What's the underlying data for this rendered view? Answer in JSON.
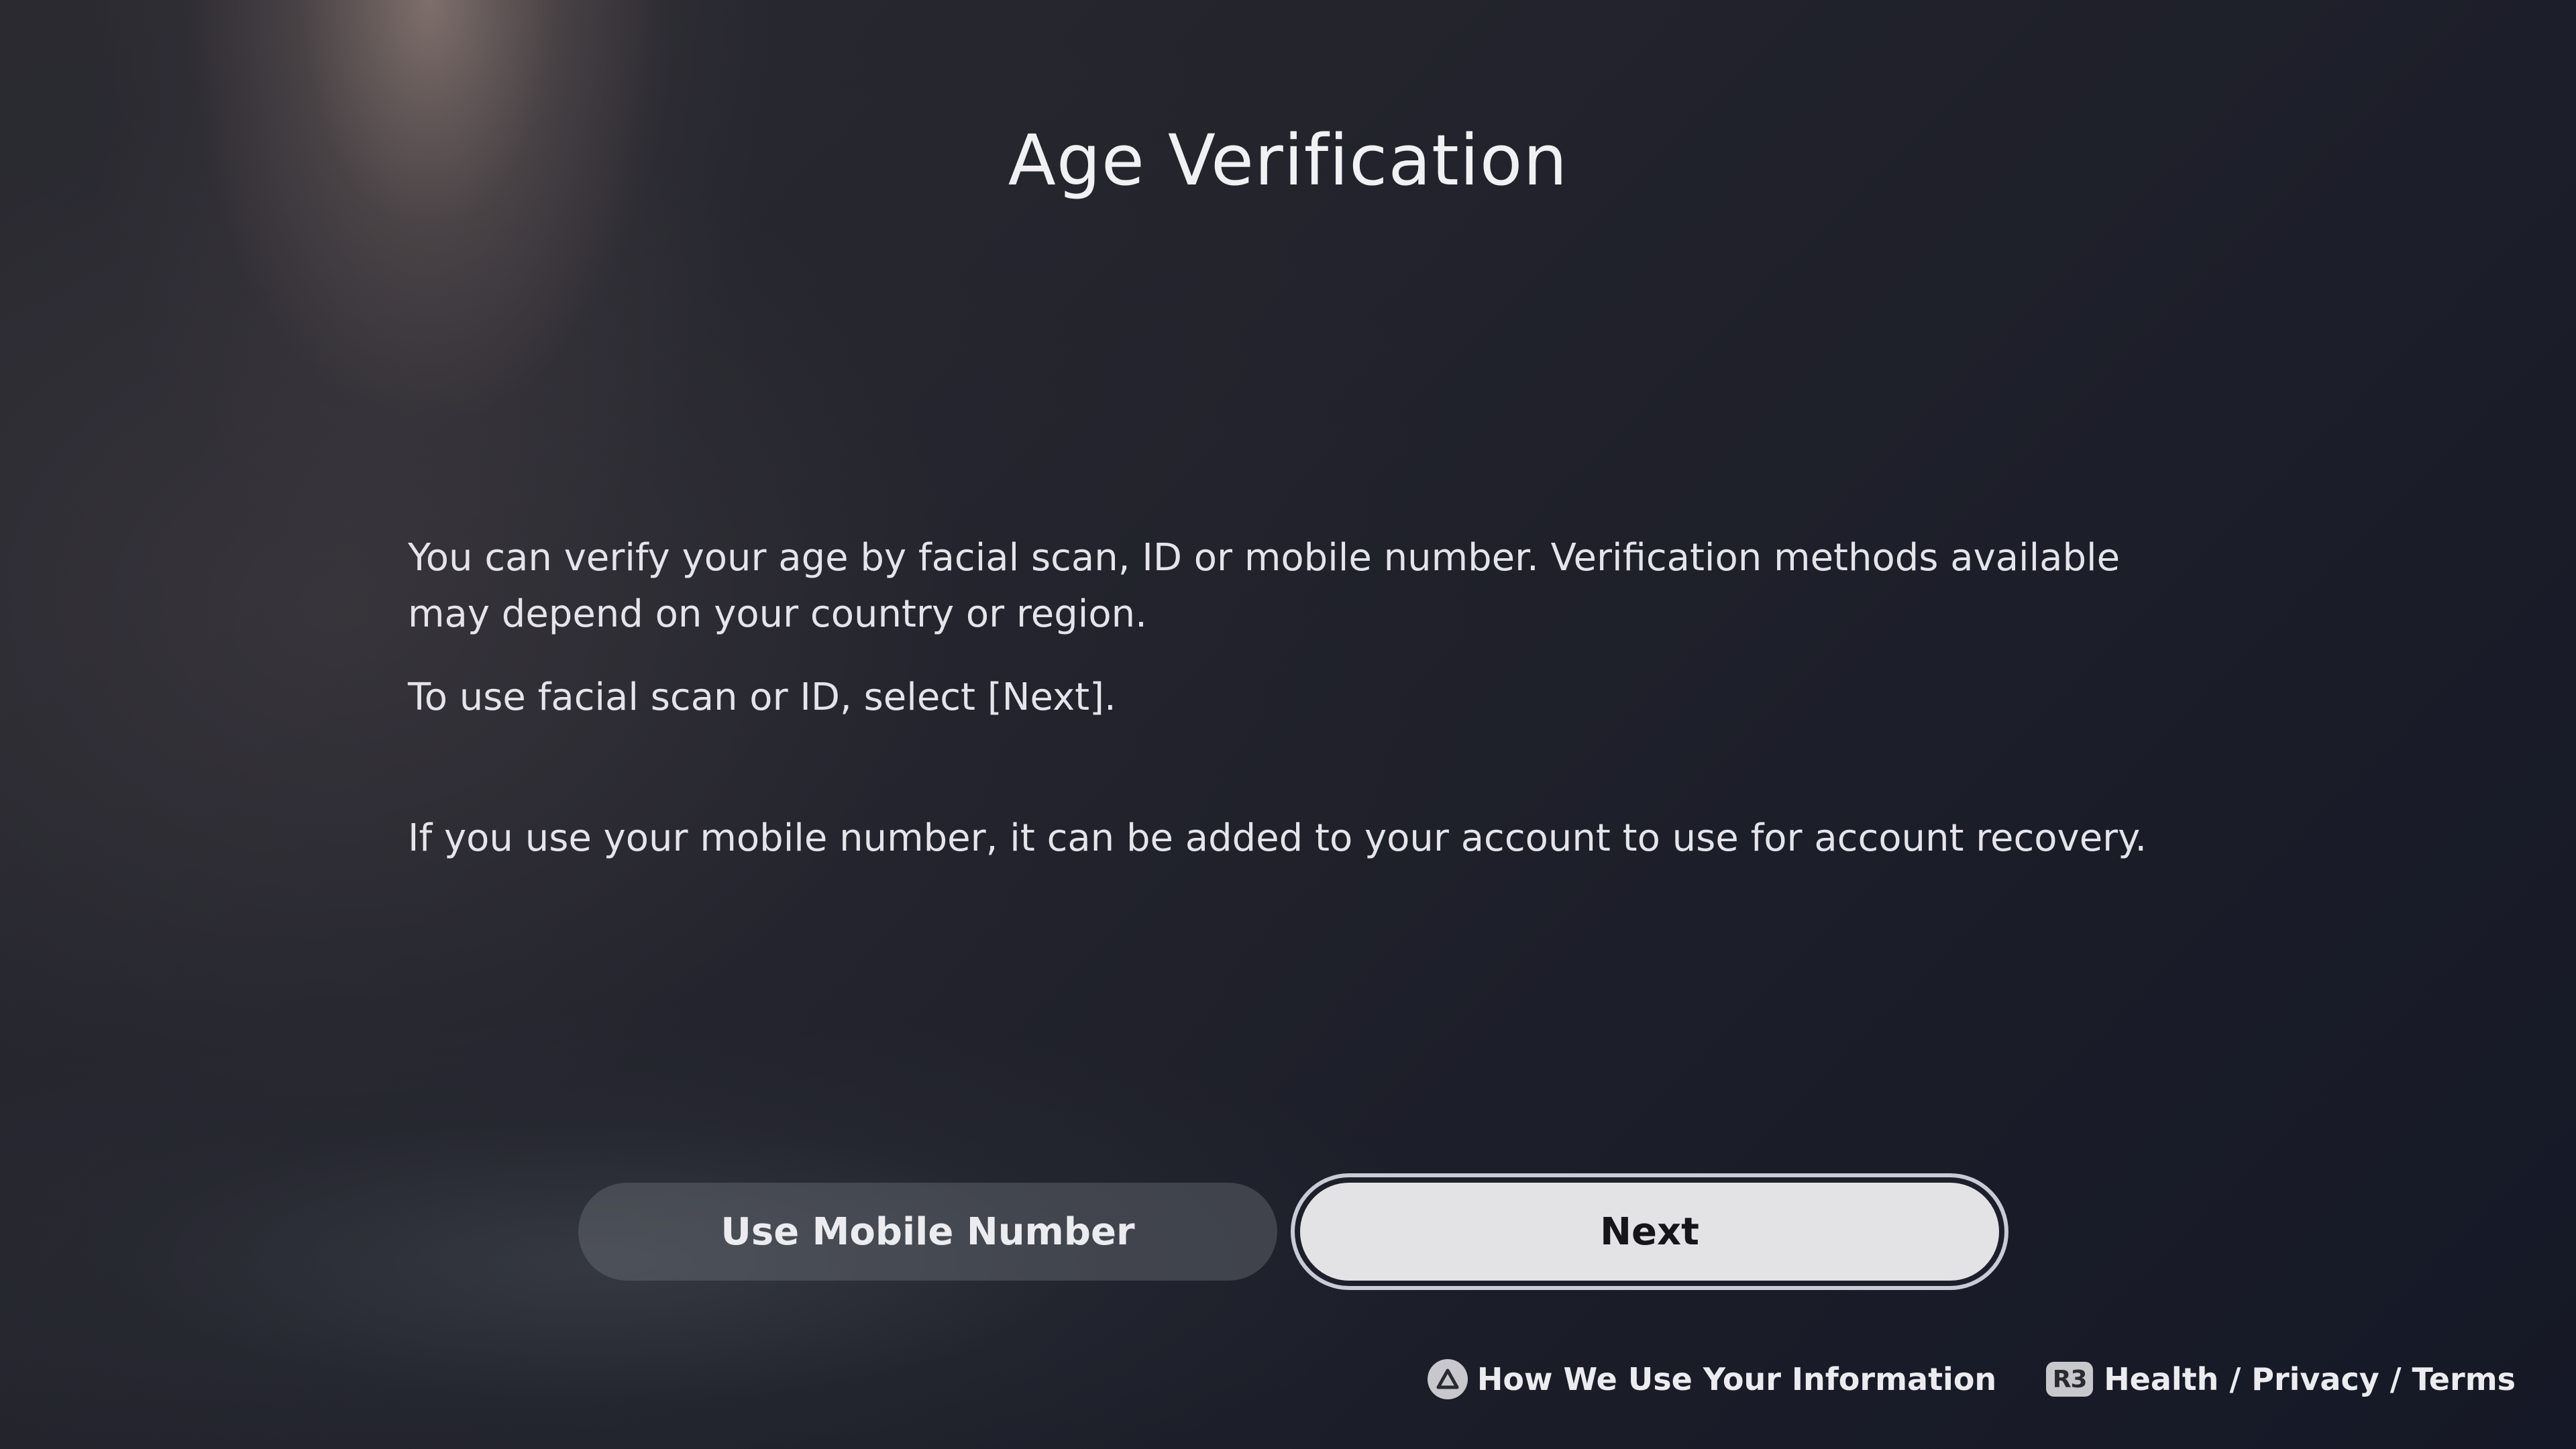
{
  "page": {
    "title": "Age Verification"
  },
  "content": {
    "paragraph1": "You can verify your age by facial scan, ID or mobile number. Verification methods available may depend on your country or region.",
    "paragraph2": "To use facial scan or ID, select [Next].",
    "paragraph3": "If you use your mobile number, it can be added to your account to use for account recovery."
  },
  "buttons": {
    "mobile_label": "Use Mobile Number",
    "next_label": "Next"
  },
  "footer": {
    "info_icon": "triangle-button-icon",
    "info_label": "How We Use Your Information",
    "legal_icon_label": "R3",
    "legal_label": "Health / Privacy / Terms"
  },
  "colors": {
    "background": "#1a1c25",
    "focused_button": "#e3e3e5",
    "secondary_button": "#4a4d55"
  }
}
